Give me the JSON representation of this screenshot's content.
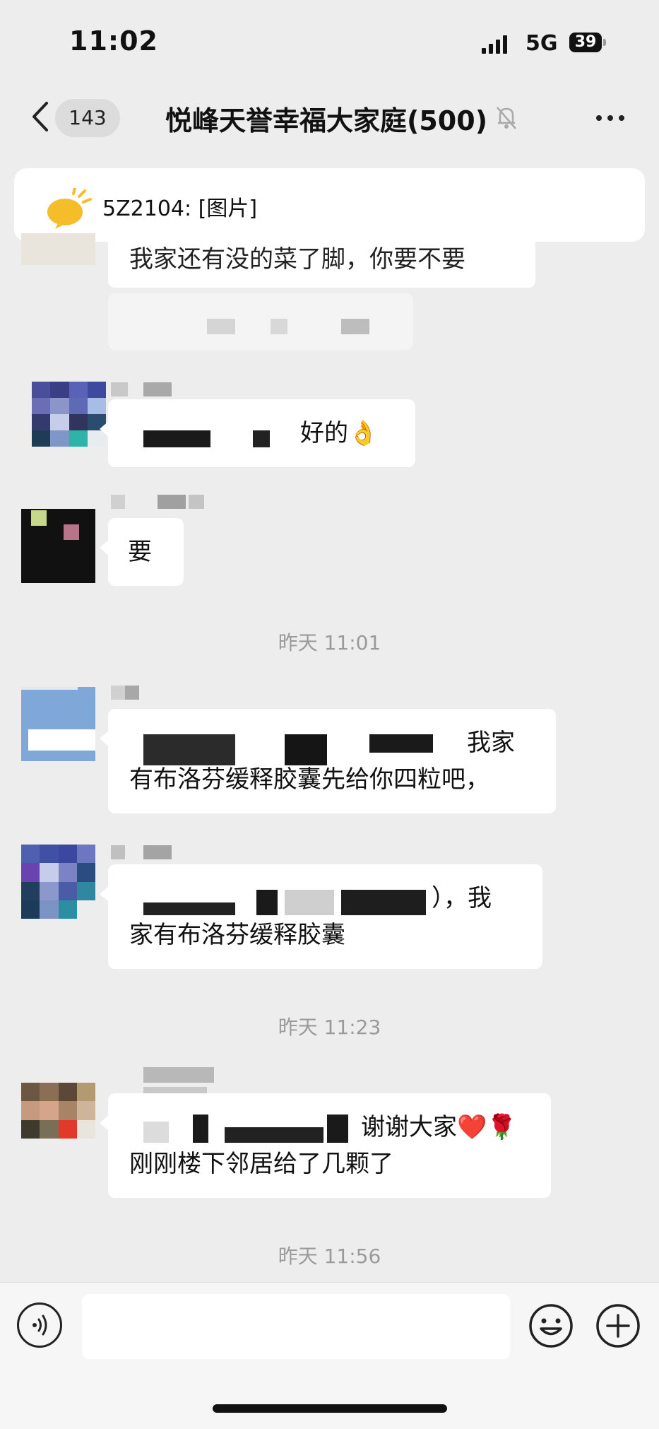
{
  "status_bar": {
    "time": "11:02",
    "network": "5G",
    "battery": "39"
  },
  "nav": {
    "back_count": "143",
    "title": "悦峰天誉幸福大家庭(500)"
  },
  "pinned": {
    "text": "5Z2104: [图片]"
  },
  "messages": [
    {
      "id": "m0",
      "text": "我家还有没的菜了脚，你要不要"
    },
    {
      "id": "m1",
      "text": "好的👌"
    },
    {
      "id": "m2",
      "text": "要"
    },
    {
      "id": "m3",
      "line1": "我家",
      "line2": "有布洛芬缓释胶囊先给你四粒吧，"
    },
    {
      "id": "m4",
      "line1": "），我",
      "line2": "家有布洛芬缓释胶囊"
    },
    {
      "id": "m5",
      "line1": "谢谢大家❤️🌹",
      "line2": "刚刚楼下邻居给了几颗了"
    }
  ],
  "timestamps": [
    "昨天 11:01",
    "昨天 11:23",
    "昨天 11:56"
  ],
  "input": {
    "placeholder": ""
  },
  "colors": {
    "background": "#ededed",
    "bubble": "#ffffff",
    "timestamp": "#9a9a9a"
  }
}
